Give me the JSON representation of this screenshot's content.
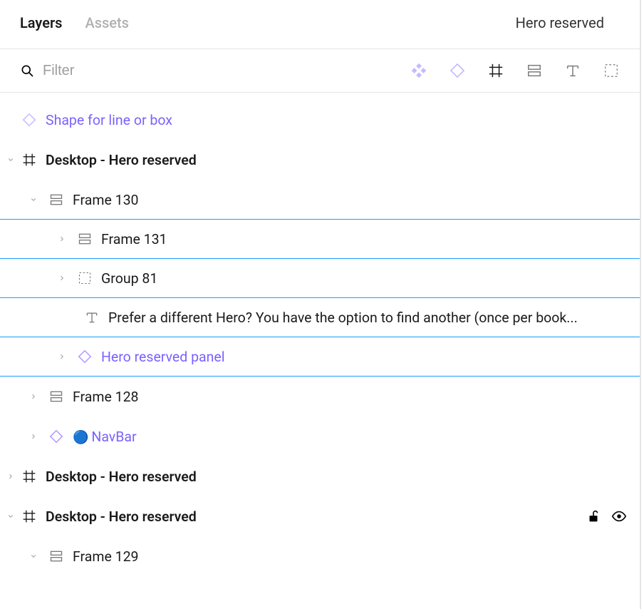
{
  "header": {
    "tabs": {
      "layers": "Layers",
      "assets": "Assets"
    },
    "page_selector": "Hero reserved"
  },
  "filter": {
    "placeholder": "Filter",
    "icons": {
      "component": "component-icon",
      "instance": "instance-icon",
      "frame": "frame-icon",
      "autolayout": "autolayout-icon",
      "text": "text-icon",
      "group": "group-icon"
    }
  },
  "layers": {
    "shape": "Shape for line or box",
    "top_frame_a": "Desktop - Hero reserved",
    "frame130": "Frame 130",
    "frame131": "Frame 131",
    "group81": "Group 81",
    "prefer_text": "Prefer a different Hero? You have the option to find another (once per book...",
    "hero_panel": "Hero reserved panel",
    "frame128": "Frame 128",
    "navbar_emoji": "🔵",
    "navbar_label": "NavBar",
    "top_frame_b": "Desktop - Hero reserved",
    "top_frame_c": "Desktop - Hero reserved",
    "frame129": "Frame 129"
  }
}
